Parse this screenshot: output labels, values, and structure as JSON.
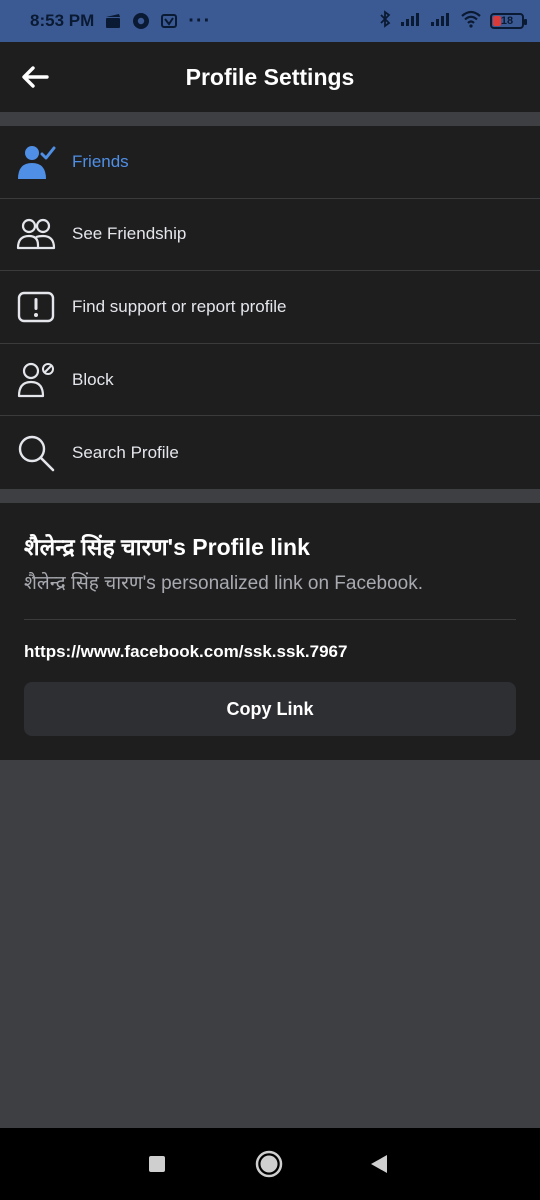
{
  "status_bar": {
    "time": "8:53 PM",
    "dots": "···",
    "battery_level": "18",
    "icons": [
      "clapper-icon",
      "chrome-icon",
      "app-icon",
      "bluetooth-icon",
      "signal-icon",
      "signal-icon",
      "wifi-icon",
      "battery-icon"
    ],
    "colors": {
      "background": "#3b5a94",
      "battery_low": "#d93a3a"
    }
  },
  "header": {
    "title": "Profile Settings",
    "back_icon": "back-arrow-icon"
  },
  "menu": {
    "items": [
      {
        "label": "Friends",
        "icon": "friends-check-icon",
        "active": true
      },
      {
        "label": "See Friendship",
        "icon": "two-people-icon",
        "active": false
      },
      {
        "label": "Find support or report profile",
        "icon": "report-exclamation-icon",
        "active": false
      },
      {
        "label": "Block",
        "icon": "block-person-icon",
        "active": false
      },
      {
        "label": "Search Profile",
        "icon": "search-icon",
        "active": false
      }
    ],
    "active_color": "#4f8fe6"
  },
  "profile_link": {
    "title": "शैलेन्द्र सिंह चारण's Profile link",
    "subtitle": "शैलेन्द्र सिंह चारण's personalized link on Facebook.",
    "url": "https://www.facebook.com/ssk.ssk.7967",
    "copy_label": "Copy Link"
  },
  "nav_bar": {
    "buttons": [
      "recents-square-icon",
      "home-circle-icon",
      "back-triangle-icon"
    ]
  }
}
